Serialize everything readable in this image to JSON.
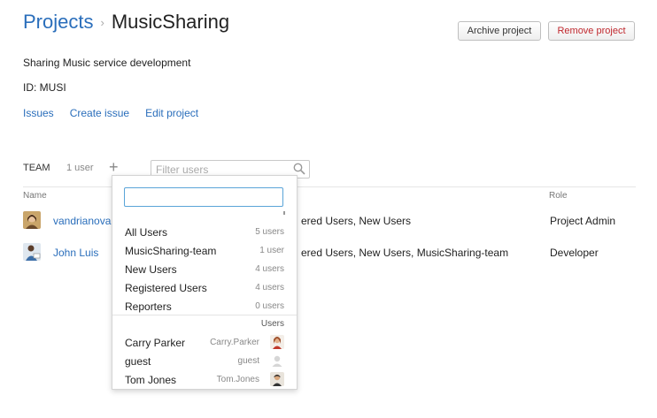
{
  "breadcrumb": {
    "root": "Projects",
    "separator": "›",
    "current": "MusicSharing"
  },
  "header": {
    "archive_label": "Archive project",
    "remove_label": "Remove project"
  },
  "project": {
    "description": "Sharing Music service development",
    "id_line": "ID: MUSI",
    "links": [
      "Issues",
      "Create issue",
      "Edit project"
    ]
  },
  "team": {
    "title": "TEAM",
    "count": "1 user",
    "add_symbol": "+",
    "filter_placeholder": "Filter users",
    "columns": {
      "name": "Name",
      "role": "Role"
    },
    "rows": [
      {
        "name": "vandrianova",
        "groups": "ered Users, New Users",
        "role": "Project Admin"
      },
      {
        "name": "John Luis",
        "groups": "ered Users, New Users, MusicSharing-team",
        "role": "Developer"
      }
    ]
  },
  "dropdown": {
    "search_value": "",
    "groups": [
      {
        "label": "All Users",
        "count": "5 users"
      },
      {
        "label": "MusicSharing-team",
        "count": "1 user"
      },
      {
        "label": "New Users",
        "count": "4 users"
      },
      {
        "label": "Registered Users",
        "count": "4 users"
      },
      {
        "label": "Reporters",
        "count": "0 users"
      }
    ],
    "users_section": "Users",
    "users": [
      {
        "name": "Carry Parker",
        "login": "Carry.Parker"
      },
      {
        "name": "guest",
        "login": "guest"
      },
      {
        "name": "Tom Jones",
        "login": "Tom.Jones"
      }
    ]
  },
  "colors": {
    "link": "#2a6ebb",
    "danger": "#c0282e",
    "focus": "#5aa4d8"
  }
}
